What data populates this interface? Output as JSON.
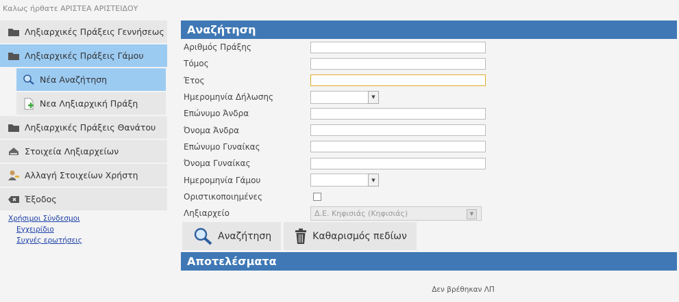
{
  "header": {
    "welcome": "Καλως ήρθατε ΑΡΙΣΤΕΑ ΑΡΙΣΤΕΙΔΟΥ"
  },
  "sidebar": {
    "items": [
      {
        "label": "Ληξιαρχικές Πράξεις Γεννήσεως",
        "icon": "folder-icon"
      },
      {
        "label": "Ληξιαρχικές Πράξεις Γάμου",
        "icon": "folder-icon"
      },
      {
        "label": "Νέα Αναζήτηση",
        "icon": "search-icon"
      },
      {
        "label": "Νεα Ληξιαρχική Πράξη",
        "icon": "new-document-icon"
      },
      {
        "label": "Ληξιαρχικές Πράξεις Θανάτου",
        "icon": "folder-icon"
      },
      {
        "label": "Στοιχεία Ληξιαρχείων",
        "icon": "stamp-icon"
      },
      {
        "label": "Αλλαγή Στοιχείων Χρήστη",
        "icon": "user-key-icon"
      },
      {
        "label": "Έξοδος",
        "icon": "exit-icon"
      }
    ],
    "links": [
      {
        "label": "Χρήσιμοι Σύνδεσμοι"
      },
      {
        "label": "Εγχειρίδιο"
      },
      {
        "label": "Συχνές ερωτήσεις"
      }
    ]
  },
  "search": {
    "title": "Αναζήτηση",
    "fields": {
      "act_number": {
        "label": "Αριθμός Πράξης",
        "value": ""
      },
      "volume": {
        "label": "Τόμος",
        "value": ""
      },
      "year": {
        "label": "Έτος",
        "value": ""
      },
      "declaration_date": {
        "label": "Ημερομηνία Δήλωσης",
        "value": ""
      },
      "husband_surname": {
        "label": "Επώνυμο Άνδρα",
        "value": ""
      },
      "husband_name": {
        "label": "Όνομα Άνδρα",
        "value": ""
      },
      "wife_surname": {
        "label": "Επώνυμο Γυναίκας",
        "value": ""
      },
      "wife_name": {
        "label": "Όνομα Γυναίκας",
        "value": ""
      },
      "marriage_date": {
        "label": "Ημερομηνία Γάμου",
        "value": ""
      },
      "finalized": {
        "label": "Οριστικοποιημένες",
        "checked": false
      },
      "registry": {
        "label": "Ληξιαρχείο",
        "value": "Δ.Ε. Κηφισιάς (Κηφισιάς)"
      }
    },
    "buttons": {
      "search": "Αναζήτηση",
      "clear": "Καθαρισμός πεδίων"
    }
  },
  "results": {
    "title": "Αποτελέσματα",
    "empty_message": "Δεν βρέθηκαν ΛΠ"
  },
  "colors": {
    "header_blue": "#3f78b5",
    "active_item": "#9ccbf2",
    "focus_border": "#e0a92a"
  }
}
